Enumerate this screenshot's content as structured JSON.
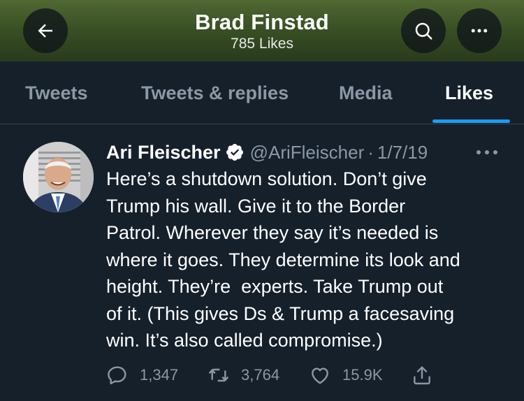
{
  "header": {
    "title": "Brad Finstad",
    "subtitle": "785 Likes"
  },
  "tabs": [
    {
      "label": "Tweets"
    },
    {
      "label": "Tweets & replies"
    },
    {
      "label": "Media"
    },
    {
      "label": "Likes",
      "active": true
    }
  ],
  "tweet": {
    "name": "Ari Fleischer",
    "handle": "@AriFleischer",
    "separator": "·",
    "date": "1/7/19",
    "text": "Here’s a shutdown solution. Don’t give\nTrump his wall. Give it to the Border\nPatrol. Wherever they say it’s needed is\nwhere it goes. They determine its look and\nheight. They’re  experts. Take Trump out\nof it. (This gives Ds & Trump a facesaving\nwin. It’s also called compromise.)",
    "replies": "1,347",
    "retweets": "3,764",
    "likes": "15.9K"
  },
  "icons": [
    "back-arrow-icon",
    "search-icon",
    "more-icon",
    "verified-badge-icon",
    "reply-icon",
    "retweet-icon",
    "like-icon",
    "share-icon"
  ],
  "colors": {
    "background": "#15202b",
    "accent": "#1d9bf0",
    "muted_text": "#8b98a5",
    "divider": "#38444d"
  }
}
